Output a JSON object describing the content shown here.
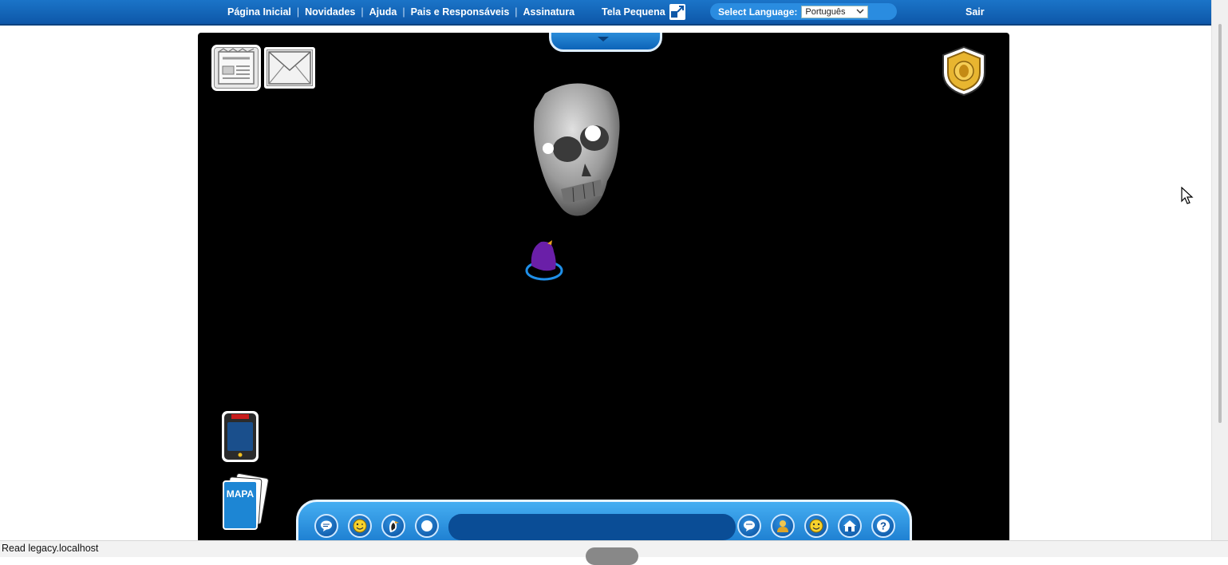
{
  "nav": {
    "links": [
      "Página Inicial",
      "Novidades",
      "Ajuda",
      "Pais e Responsáveis",
      "Assinatura"
    ],
    "separator": "|",
    "small_screen_label": "Tela Pequena",
    "small_screen_icon": "resize-window-icon",
    "language_label": "Select Language:",
    "language_value": "Português",
    "logout_label": "Sair"
  },
  "game": {
    "top_tab_icon": "chevron-down-icon",
    "newspaper_icon": "newspaper-icon",
    "mail_icon": "envelope-icon",
    "badge_icon": "moderator-badge-icon",
    "phone_icon": "spy-phone-icon",
    "map_label": "MAPA",
    "toolbar": {
      "left_buttons": [
        "speech-bubble-icon",
        "emote-icon",
        "penguin-action-icon",
        "snowball-icon"
      ],
      "right_buttons": [
        "message-icon",
        "player-list-icon",
        "friends-icon",
        "igloo-home-icon",
        "help-icon"
      ]
    }
  },
  "status_bar": {
    "text": "Read legacy.localhost"
  },
  "colors": {
    "nav_blue": "#0d57a8",
    "toolbar_blue": "#1b84d8",
    "penguin_purple": "#6a1fa8"
  }
}
